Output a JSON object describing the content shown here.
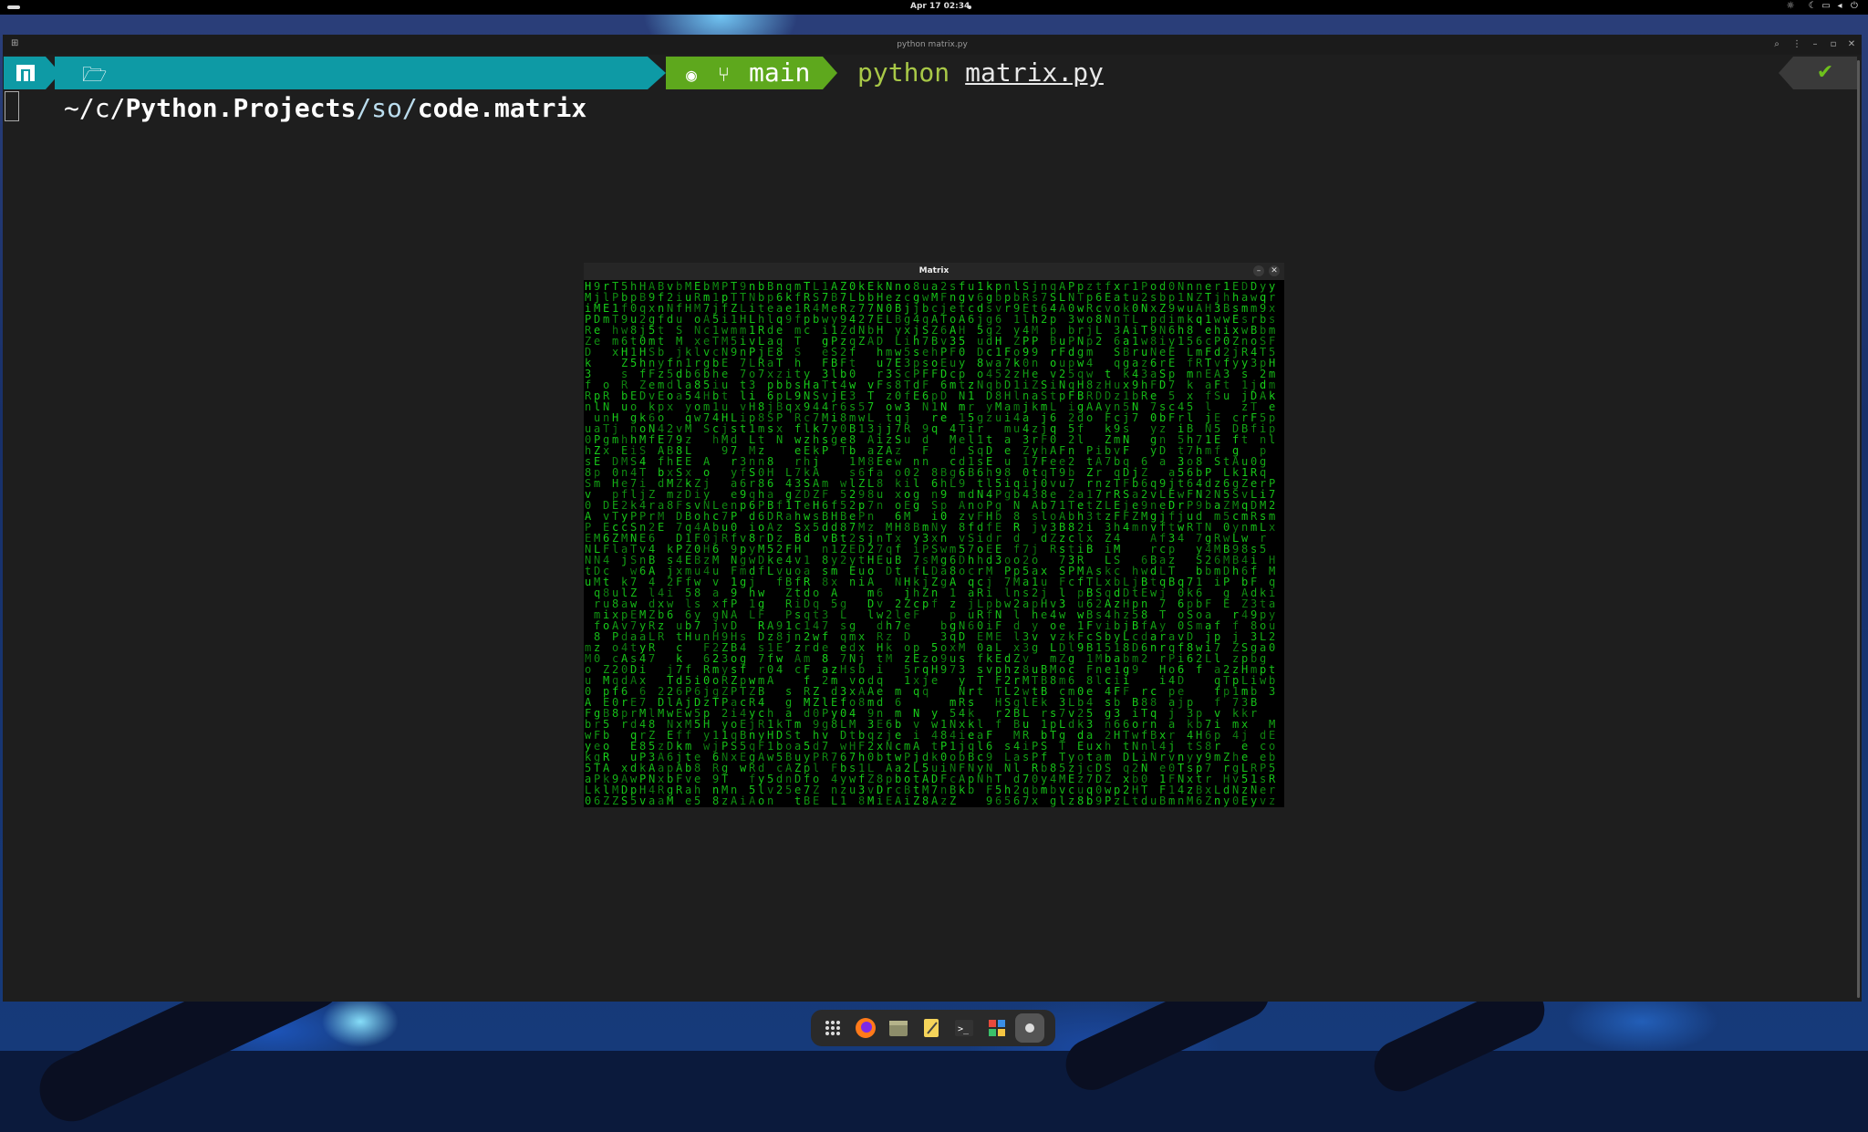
{
  "topbar": {
    "clock": "Apr 17 02:34",
    "tray_icons": [
      "brightness-icon",
      "night-light-icon",
      "screen-icon",
      "volume-icon",
      "power-icon"
    ]
  },
  "terminal": {
    "window_title": "python matrix.py",
    "prompt": {
      "os_icon": "manjaro-logo-icon",
      "folder_icon": "folder-open-icon",
      "path_prefix": "~/c/",
      "path_bold": "Python.Projects",
      "path_sep": "/so/",
      "path_current": "code.matrix",
      "git_icons": [
        "github-icon",
        "git-branch-icon"
      ],
      "branch": "main",
      "command": "python",
      "argument": "matrix.py",
      "status_icon": "✔"
    },
    "colors": {
      "path_bg": "#0e9aa5",
      "git_bg": "#5ea81d",
      "command": "#a8c847",
      "status": "#6ec11c",
      "background": "#1e1e1e"
    }
  },
  "matrix_window": {
    "title": "Matrix",
    "text_color": "#19d31b",
    "charset": "abcdefghijklmnopqrstuvwxyzABDEFHLMNPRSTZ0123456789"
  },
  "dock": {
    "items": [
      {
        "name": "app-grid-icon",
        "glyph": "⋮⋮⋮"
      },
      {
        "name": "firefox-icon",
        "glyph": "●"
      },
      {
        "name": "files-icon",
        "glyph": "▭"
      },
      {
        "name": "text-editor-icon",
        "glyph": "✎"
      },
      {
        "name": "terminal-icon",
        "glyph": ">_"
      },
      {
        "name": "software-center-icon",
        "glyph": "▦"
      },
      {
        "name": "running-app-icon",
        "glyph": "●"
      }
    ]
  }
}
